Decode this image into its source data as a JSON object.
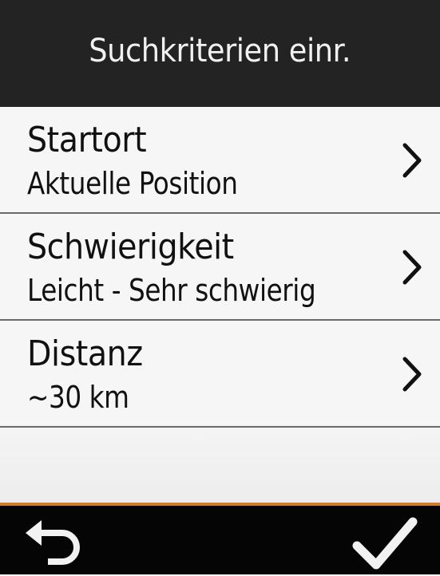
{
  "header": {
    "title": "Suchkriterien einr."
  },
  "criteria": [
    {
      "title": "Startort",
      "value": "Aktuelle Position"
    },
    {
      "title": "Schwierigkeit",
      "value": "Leicht - Sehr schwierig"
    },
    {
      "title": "Distanz",
      "value": "~30 km"
    }
  ],
  "footer": {
    "back_icon": "back-arrow-icon",
    "confirm_icon": "checkmark-icon"
  },
  "colors": {
    "header_bg": "#232323",
    "footer_bg": "#050505",
    "accent": "#d47a2c",
    "list_bg": "#f6f6f6"
  }
}
